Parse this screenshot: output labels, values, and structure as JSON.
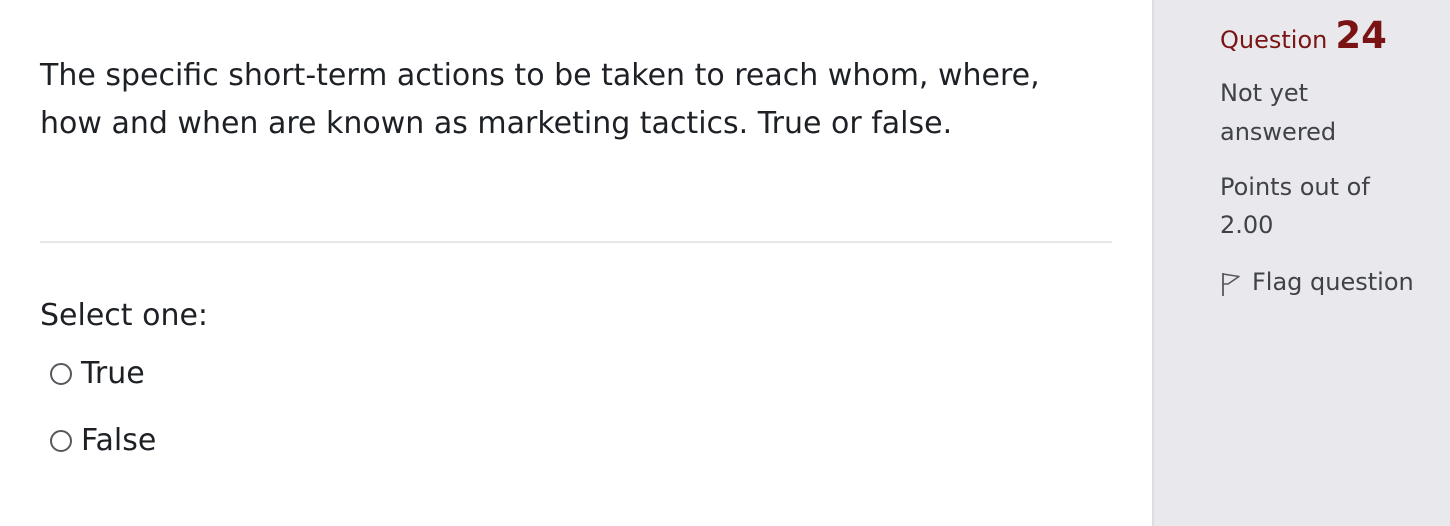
{
  "question": {
    "text": "The specific short-term actions to be taken to reach whom, where, how and when are known as marketing tactics. True or false.",
    "prompt": "Select one:",
    "options": [
      {
        "label": "True",
        "selected": false
      },
      {
        "label": "False",
        "selected": false
      }
    ]
  },
  "info": {
    "question_word": "Question",
    "question_number": "24",
    "state": "Not yet answered",
    "grade": "Points out of 2.00",
    "flag_label": "Flag question"
  },
  "colors": {
    "accent": "#7a1414",
    "sidebar_bg": "#e9e9ed",
    "text": "#1d2125",
    "muted_text": "#3f4347"
  },
  "icons": {
    "flag": "flag-outline-icon",
    "radio": "radio-unchecked-icon"
  }
}
